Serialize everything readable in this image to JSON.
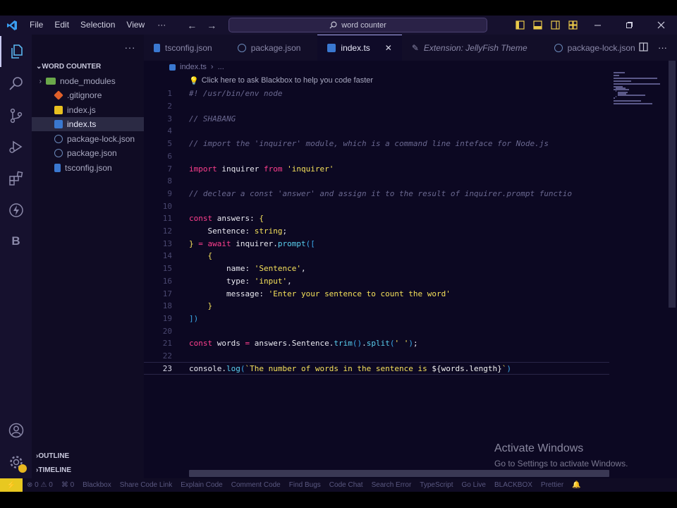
{
  "titlebar": {
    "menu": [
      "File",
      "Edit",
      "Selection",
      "View"
    ],
    "more": "···",
    "back_arrow": "←",
    "forward_arrow": "→",
    "search_text": "word counter"
  },
  "sidebar": {
    "explorer_more": "···",
    "project": "WORD COUNTER",
    "files": [
      {
        "name": "node_modules",
        "icon": "folder-icon",
        "color": "#6aa84a",
        "folder": true
      },
      {
        "name": ".gitignore",
        "icon": "git-icon",
        "color": "#e0602a"
      },
      {
        "name": "index.js",
        "icon": "js-icon",
        "color": "#e8c020"
      },
      {
        "name": "index.ts",
        "icon": "ts-icon",
        "color": "#3a78d0",
        "selected": true
      },
      {
        "name": "package-lock.json",
        "icon": "json-icon",
        "color": "#6a88b8"
      },
      {
        "name": "package.json",
        "icon": "json-icon",
        "color": "#6a88b8"
      },
      {
        "name": "tsconfig.json",
        "icon": "tsconfig-icon",
        "color": "#3a78d0"
      }
    ],
    "outline": "OUTLINE",
    "timeline": "TIMELINE"
  },
  "tabs": [
    {
      "label": "tsconfig.json",
      "icon": "tsconfig-icon"
    },
    {
      "label": "package.json",
      "icon": "json-icon"
    },
    {
      "label": "index.ts",
      "icon": "ts-icon",
      "active": true
    },
    {
      "label": "Extension: JellyFish Theme",
      "icon": "extension-icon",
      "italic": true
    },
    {
      "label": "package-lock.json",
      "icon": "json-icon"
    }
  ],
  "editor": {
    "breadcrumb_file": "index.ts",
    "breadcrumb_more": "...",
    "close_glyph": "✕",
    "hint": "Click here to ask Blackbox to help you code faster",
    "current_line": 23,
    "lines": [
      "#! /usr/bin/env node",
      "",
      "// SHABANG",
      "",
      "// import the 'inquirer' module, which is a command line inteface for Node.js",
      "",
      "import inquirer from 'inquirer'",
      "",
      "// declear a const 'answer' and assign it to the result of inquirer.prompt functio",
      "",
      "const answers: {",
      "    Sentence: string;",
      "} = await inquirer.prompt([",
      "    {",
      "        name: 'Sentence',",
      "        type: 'input',",
      "        message: 'Enter your sentence to count the word'",
      "    }",
      "])",
      "",
      "const words = answers.Sentence.trim().split(' ');",
      "",
      "console.log(`The number of words in the sentence is ${words.length}`)"
    ]
  },
  "watermark": {
    "title": "Activate Windows",
    "subtitle": "Go to Settings to activate Windows."
  },
  "statusbar": {
    "remote": "⚡",
    "problems": "⊗ 0 ⚠ 0",
    "ports": "⌘ 0",
    "items": [
      "Blackbox",
      "Share Code Link",
      "Explain Code",
      "Comment Code",
      "Find Bugs",
      "Code Chat",
      "Search Error",
      "TypeScript",
      "Go Live",
      "BLACKBOX",
      "Prettier"
    ]
  }
}
